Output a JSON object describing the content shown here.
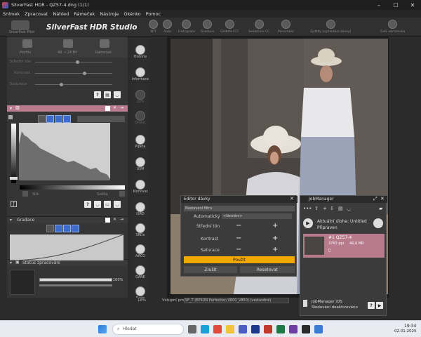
{
  "window": {
    "title": "SilverFast HDR - QZ57-4.dng (1/1)"
  },
  "menu": [
    "Snímek",
    "Zpracovat",
    "Náhled",
    "Rámeček",
    "Nástroje",
    "Okénko",
    "Pomoc"
  ],
  "brand": {
    "name": "SilverFast HDR Studio",
    "badge_label": "SilverFast Pilot"
  },
  "toolbar": {
    "tools": [
      "WiT",
      "Auto",
      "Histogram",
      "Gradace",
      "Globální CC",
      "Selektivní CC",
      "Porovnání",
      "Zpátky (vyhledání dávky)",
      "Celá obrazovka"
    ]
  },
  "left_panel": {
    "top_tabs": [
      "Pozitiv",
      "48 → 24 Bit",
      "Rámeček"
    ],
    "sliders": [
      "Střední tón",
      "Kontrast",
      "Saturace"
    ],
    "histogram_labels": {
      "left": "Stín",
      "right": "Světla"
    },
    "gradation_title": "Gradace",
    "status_title": "Status zpracování",
    "status_percent": "100%"
  },
  "vertical_tools": [
    {
      "label": "Historie",
      "active": true
    },
    {
      "label": "Informace",
      "active": true
    },
    {
      "label": "10%",
      "active": false
    },
    {
      "label": "Oranž.",
      "active": false
    },
    {
      "label": "Pipeta",
      "active": true
    },
    {
      "label": "USM",
      "active": true
    },
    {
      "label": "Klonovat",
      "active": true
    },
    {
      "label": "iSRD",
      "active": true
    },
    {
      "label": "SRDx",
      "active": true
    },
    {
      "label": "AACO",
      "active": true
    },
    {
      "label": "GANE",
      "active": true
    },
    {
      "label": "Rastr",
      "active": true
    }
  ],
  "bottom_strip": {
    "zoom": "18%",
    "profile_label": "Vstupní profil:",
    "profile_value": "SF_T (EPSON Perfection V800_V850) (vestavěné)"
  },
  "editor": {
    "title": "Editor dávky",
    "filter": "Nastavení filtru",
    "auto_label": "Automatický",
    "auto_value": "<Nemění>",
    "rows": [
      "Střední tón",
      "Kontrast",
      "Saturace"
    ],
    "apply": "Použít",
    "cancel": "Zrušit",
    "reset": "Resetovat"
  },
  "jobmanager": {
    "title": "JobManager",
    "current_task": "Aktuální úloha: Untitled",
    "state": "Připraven",
    "item_name": "#1 QZ57-4",
    "item_dpi": "3763 ppi",
    "item_size": "46,6 MB",
    "footer_line1": "JobManager iOS",
    "footer_line2": "Sledování deaktivováno"
  },
  "taskbar": {
    "search_placeholder": "Hledat",
    "time": "19:34",
    "date": "02.01.2025"
  },
  "colors": {
    "accent_pink": "#b87b8e",
    "apply_orange": "#f2a800",
    "selected_blue": "#3c6cc8"
  }
}
